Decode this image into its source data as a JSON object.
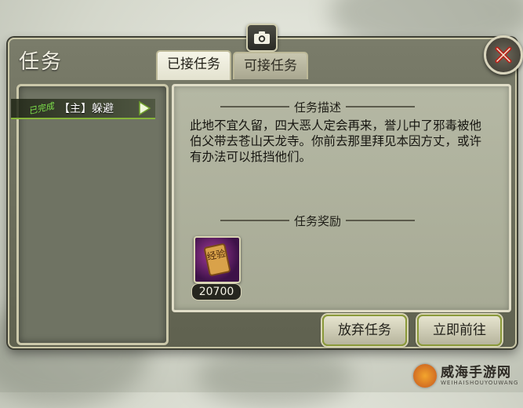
{
  "window": {
    "title": "任务"
  },
  "tabs": [
    {
      "label": "已接任务",
      "active": true
    },
    {
      "label": "可接任务",
      "active": false
    }
  ],
  "quest_list": {
    "items": [
      {
        "tag": "已完成",
        "label": "【主】躲避",
        "selected": true
      }
    ]
  },
  "detail": {
    "description_heading": "任务描述",
    "description": "此地不宜久留，四大恶人定会再来，誉儿中了邪毒被他伯父带去苍山天龙寺。你前去那里拜见本因方丈，或许有办法可以抵挡他们。",
    "reward_heading": "任务奖励",
    "reward": {
      "icon": "experience-scroll-icon",
      "icon_text": "经验",
      "amount": "20700"
    }
  },
  "buttons": {
    "abandon": "放弃任务",
    "go_now": "立即前往"
  },
  "watermark": {
    "text": "威海手游网",
    "subtext": "WEIHAISHOUYOUWANG"
  },
  "colors": {
    "panel_frame": "#5f614f",
    "detail_bg": "#b5b8a4",
    "selected_underline": "#86b43a",
    "tag_green": "#7de04a"
  }
}
